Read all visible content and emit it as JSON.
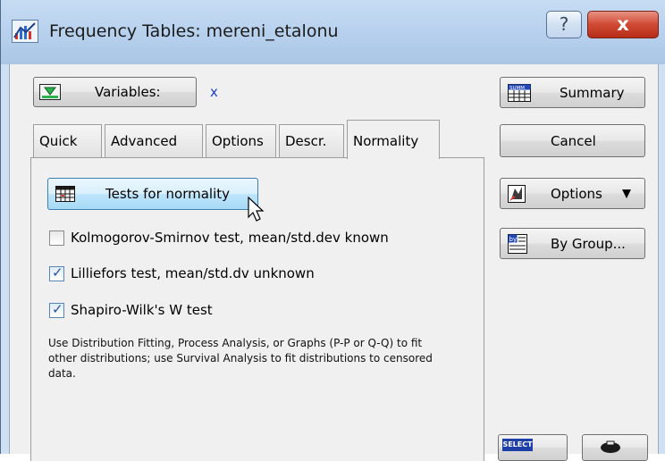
{
  "window": {
    "title": "Frequency Tables: mereni_etalonu",
    "help_symbol": "?",
    "close_symbol": "x",
    "app_icon": "chart-app-icon"
  },
  "variables": {
    "button_label": "Variables:",
    "button_icon": "green-arrow-icon",
    "value": "x"
  },
  "tabs": [
    {
      "label": "Quick",
      "active": false
    },
    {
      "label": "Advanced",
      "active": false
    },
    {
      "label": "Options",
      "active": false
    },
    {
      "label": "Descr.",
      "active": false
    },
    {
      "label": "Normality",
      "active": true
    }
  ],
  "normality": {
    "tests_button_label": "Tests for normality",
    "tests_button_icon": "table-grid-icon",
    "checkboxes": [
      {
        "label": "Kolmogorov-Smirnov test, mean/std.dev known",
        "checked": false
      },
      {
        "label": "Lilliefors test, mean/std.dv unknown",
        "checked": true
      },
      {
        "label": "Shapiro-Wilk's W test",
        "checked": true
      }
    ],
    "note": "Use Distribution Fitting, Process Analysis, or Graphs (P-P or Q-Q) to fit other distributions; use Survival Analysis to fit distributions to censored data."
  },
  "side_buttons": {
    "summary": {
      "label": "Summary",
      "icon": "summ-table-icon",
      "icon_text": "SUMM"
    },
    "cancel": {
      "label": "Cancel"
    },
    "options": {
      "label": "Options",
      "icon": "options-icon"
    },
    "by_group": {
      "label": "By Group...",
      "icon": "by-group-icon",
      "icon_text": "by"
    },
    "select": {
      "icon_text": "SELECT"
    }
  },
  "colors": {
    "accent_blue": "#1a3fd0",
    "close_red": "#cf4a34",
    "highlight": "#d9ecfb"
  }
}
